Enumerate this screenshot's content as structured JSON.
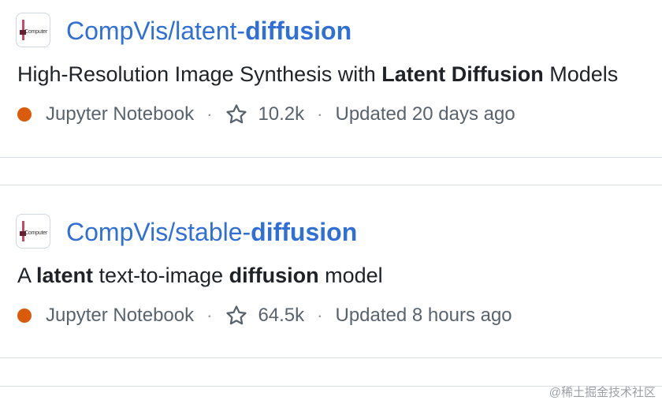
{
  "repos": [
    {
      "owner": "CompVis/",
      "name_parts": [
        "latent-",
        "diffusion"
      ],
      "avatar_text": "Computer",
      "description_parts": [
        "High-Resolution Image Synthesis with ",
        "Latent",
        " ",
        "Diffusion",
        " Models"
      ],
      "language": "Jupyter Notebook",
      "language_color": "#da5b0b",
      "stars": "10.2k",
      "updated": "Updated 20 days ago"
    },
    {
      "owner": "CompVis/",
      "name_parts": [
        "stable-",
        "diffusion"
      ],
      "avatar_text": "Computer",
      "description_parts": [
        "A ",
        "latent",
        " text-to-image ",
        "diffusion",
        " model"
      ],
      "language": "Jupyter Notebook",
      "language_color": "#da5b0b",
      "stars": "64.5k",
      "updated": "Updated 8 hours ago"
    }
  ],
  "separator": "·",
  "watermark": "@稀土掘金技术社区"
}
